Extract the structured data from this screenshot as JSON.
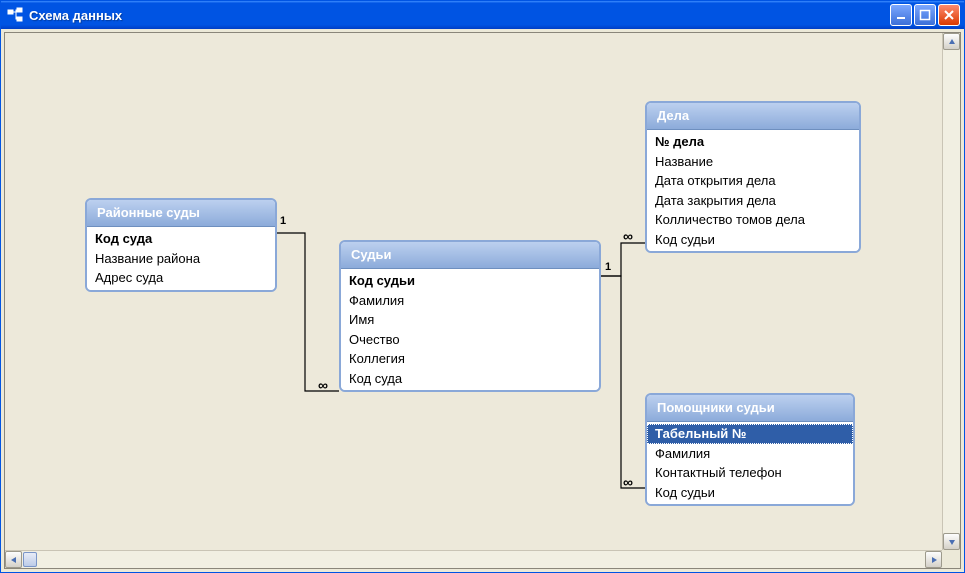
{
  "window": {
    "title": "Схема данных"
  },
  "entities": {
    "districtCourts": {
      "title": "Районные суды",
      "fields": [
        {
          "label": "Код суда",
          "bold": true
        },
        {
          "label": "Название района",
          "bold": false
        },
        {
          "label": "Адрес суда",
          "bold": false
        }
      ]
    },
    "judges": {
      "title": "Судьи",
      "fields": [
        {
          "label": "Код судьи",
          "bold": true
        },
        {
          "label": "Фамилия",
          "bold": false
        },
        {
          "label": "Имя",
          "bold": false
        },
        {
          "label": "Очество",
          "bold": false
        },
        {
          "label": "Коллегия",
          "bold": false
        },
        {
          "label": "Код суда",
          "bold": false
        }
      ]
    },
    "cases": {
      "title": "Дела",
      "fields": [
        {
          "label": "№  дела",
          "bold": true
        },
        {
          "label": "Название",
          "bold": false
        },
        {
          "label": "Дата открытия дела",
          "bold": false
        },
        {
          "label": "Дата закрытия дела",
          "bold": false
        },
        {
          "label": "Колличество томов дела",
          "bold": false
        },
        {
          "label": "Код судьи",
          "bold": false
        }
      ]
    },
    "assistants": {
      "title": "Помощники судьи",
      "fields": [
        {
          "label": "Табельный №",
          "bold": true,
          "selected": true
        },
        {
          "label": "Фамилия",
          "bold": false
        },
        {
          "label": "Контактный телефон",
          "bold": false
        },
        {
          "label": "Код судьи",
          "bold": false
        }
      ]
    }
  },
  "relations": [
    {
      "from": "districtCourts",
      "to": "judges",
      "fromCard": "1",
      "toCard": "∞"
    },
    {
      "from": "judges",
      "to": "cases",
      "fromCard": "1",
      "toCard": "∞"
    },
    {
      "from": "judges",
      "to": "assistants",
      "fromCard": "1",
      "toCard": "∞"
    }
  ],
  "cardinality": {
    "one": "1",
    "many": "∞"
  }
}
